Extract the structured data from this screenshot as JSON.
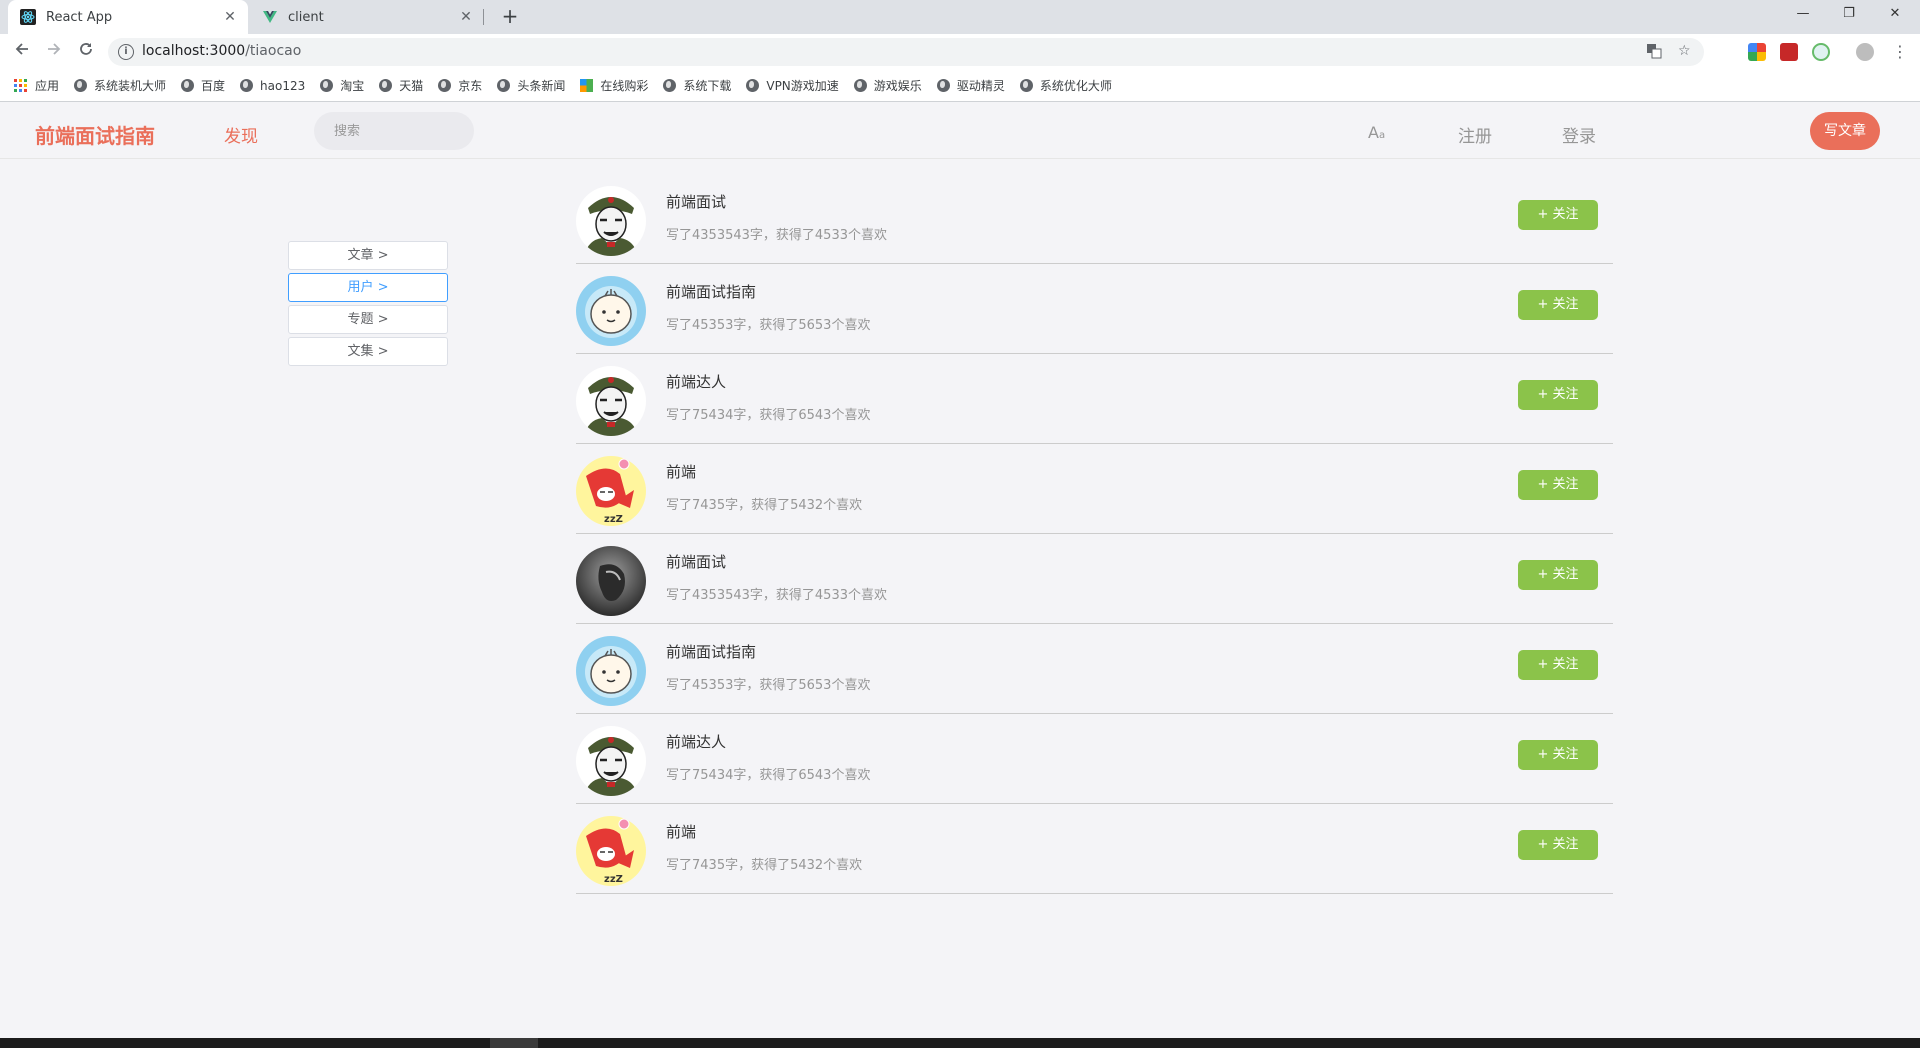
{
  "browser": {
    "tabs": [
      {
        "title": "React App",
        "active": true,
        "icon": "react-icon"
      },
      {
        "title": "client",
        "active": false,
        "icon": "vue-icon"
      }
    ],
    "new_tab": "+",
    "window_controls": {
      "minimize": "—",
      "restore": "❐",
      "close": "✕"
    },
    "url": {
      "host": "localhost:3000",
      "path": "/tiaocao"
    },
    "bookmarks": [
      {
        "label": "应用",
        "icon": "apps-grid-icon"
      },
      {
        "label": "系统装机大师",
        "icon": "globe-icon"
      },
      {
        "label": "百度",
        "icon": "globe-icon"
      },
      {
        "label": "hao123",
        "icon": "globe-icon"
      },
      {
        "label": "淘宝",
        "icon": "globe-icon"
      },
      {
        "label": "天猫",
        "icon": "globe-icon"
      },
      {
        "label": "京东",
        "icon": "globe-icon"
      },
      {
        "label": "头条新闻",
        "icon": "globe-icon"
      },
      {
        "label": "在线购彩",
        "icon": "colored-square-icon"
      },
      {
        "label": "系统下载",
        "icon": "globe-icon"
      },
      {
        "label": "VPN游戏加速",
        "icon": "globe-icon"
      },
      {
        "label": "游戏娱乐",
        "icon": "globe-icon"
      },
      {
        "label": "驱动精灵",
        "icon": "globe-icon"
      },
      {
        "label": "系统优化大师",
        "icon": "globe-icon"
      }
    ]
  },
  "header": {
    "logo": "前端面试指南",
    "discover": "发现",
    "search_placeholder": "搜索",
    "font_toggle": "A",
    "font_toggle_sub": "a",
    "register": "注册",
    "login": "登录",
    "write": "写文章"
  },
  "side_menu": [
    {
      "label": "文章 >",
      "active": false
    },
    {
      "label": "用户 >",
      "active": true
    },
    {
      "label": "专题 >",
      "active": false
    },
    {
      "label": "文集 >",
      "active": false
    }
  ],
  "follow_label": "+ 关注",
  "users": [
    {
      "name": "前端面试",
      "meta": "写了4353543字，获得了4533个喜欢",
      "avatar": "soldier"
    },
    {
      "name": "前端面试指南",
      "meta": "写了45353字，获得了5653个喜欢",
      "avatar": "bun"
    },
    {
      "name": "前端达人",
      "meta": "写了75434字，获得了6543个喜欢",
      "avatar": "soldier"
    },
    {
      "name": "前端",
      "meta": "写了7435字，获得了5432个喜欢",
      "avatar": "sleepy"
    },
    {
      "name": "前端面试",
      "meta": "写了4353543字，获得了4533个喜欢",
      "avatar": "dark"
    },
    {
      "name": "前端面试指南",
      "meta": "写了45353字，获得了5653个喜欢",
      "avatar": "bun"
    },
    {
      "name": "前端达人",
      "meta": "写了75434字，获得了6543个喜欢",
      "avatar": "soldier"
    },
    {
      "name": "前端",
      "meta": "写了7435字，获得了5432个喜欢",
      "avatar": "sleepy"
    }
  ],
  "colors": {
    "brand": "#ea6f5a",
    "follow": "#8bc34a",
    "menu_active": "#409eff"
  }
}
